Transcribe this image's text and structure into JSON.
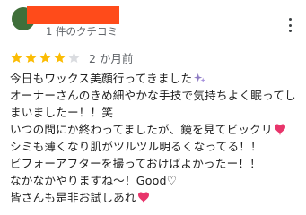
{
  "review": {
    "meta": "1 件のクチコミ",
    "rating": 4,
    "rating_max": 5,
    "time": "2 か月前",
    "lines": [
      "今日もワックス美顔行ってきました",
      "オーナーさんのきめ細やかな手技で気持ちよく眠ってし",
      "まいましたー！！笑",
      "いつの間にか終わってましたが、鏡を見てビックリ",
      "シミも薄くなり肌がツルツル明るくなってる！！",
      "ビフォーアフターを撮っておけばよかったー！！",
      "なかなかやりますね〜！Good♡",
      "皆さんも是非お試しあれ"
    ]
  },
  "icons": {
    "more": "more-vert-icon",
    "star": "star-icon",
    "sparkles_emoji": "purple-sparkles-emoji",
    "heart_emoji": "heart-with-ribbon-emoji"
  },
  "colors": {
    "star_filled": "#fbbc04",
    "star_empty": "#dadce0",
    "redaction": "#ff4b1a",
    "heart": "#e8356b",
    "sparkle": "#8e7cc3"
  }
}
